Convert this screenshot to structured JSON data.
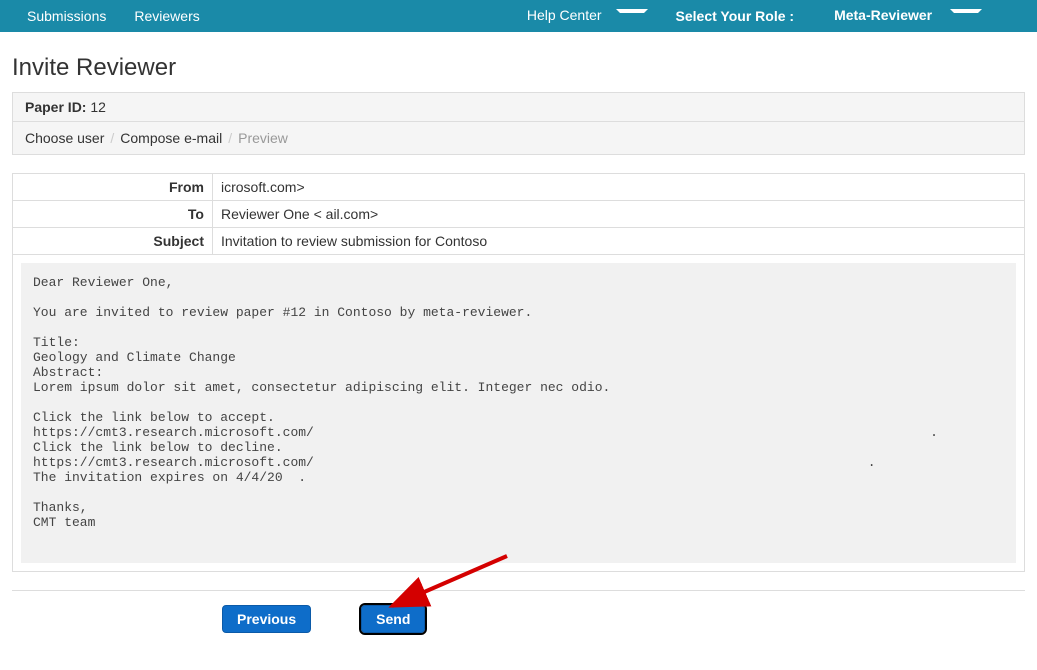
{
  "navbar": {
    "left": [
      {
        "label": "Submissions"
      },
      {
        "label": "Reviewers"
      }
    ],
    "right": {
      "help_center": "Help Center",
      "role_label": "Select Your Role :",
      "role_value": "Meta-Reviewer",
      "user_blurred": "                    "
    }
  },
  "page_title": "Invite Reviewer",
  "paper": {
    "label": "Paper ID:",
    "value": "12"
  },
  "breadcrumb": [
    {
      "label": "Choose user",
      "active": false
    },
    {
      "label": "Compose e-mail",
      "active": false
    },
    {
      "label": "Preview",
      "active": true
    }
  ],
  "fields": {
    "from_label": "From",
    "from_value": "                  icrosoft.com>",
    "to_label": "To",
    "to_value": "Reviewer One <                  ail.com>",
    "subject_label": "Subject",
    "subject_value": "Invitation to review submission for Contoso"
  },
  "email_body": "Dear Reviewer One,\n\nYou are invited to review paper #12 in Contoso by meta-reviewer.\n\nTitle:\nGeology and Climate Change\nAbstract:\nLorem ipsum dolor sit amet, consectetur adipiscing elit. Integer nec odio.\n\nClick the link below to accept.\nhttps://cmt3.research.microsoft.com/                                                                               .\nClick the link below to decline.\nhttps://cmt3.research.microsoft.com/                                                                       .\nThe invitation expires on 4/4/20  .\n\nThanks,\nCMT team",
  "buttons": {
    "previous": "Previous",
    "send": "Send"
  }
}
